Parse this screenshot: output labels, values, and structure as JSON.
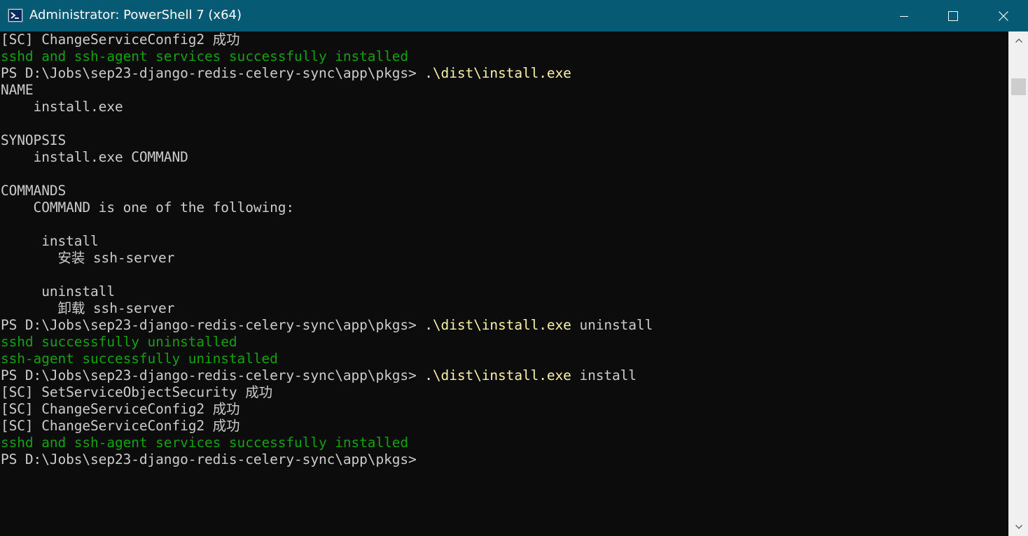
{
  "window": {
    "title": "Administrator: PowerShell 7 (x64)",
    "icon": "powershell-icon",
    "controls": [
      "minimize-icon",
      "maximize-icon",
      "close-icon"
    ]
  },
  "colors": {
    "titlebar": "#065a73",
    "console_bg": "#0c0c0c",
    "default_text": "#cccccc",
    "command_text": "#f9f1a5",
    "success_text": "#13a10e"
  },
  "console": {
    "lines": [
      [
        {
          "text": "[SC] ChangeServiceConfig2 成功",
          "style": "default"
        }
      ],
      [
        {
          "text": "sshd and ssh-agent services successfully installed",
          "style": "ok"
        }
      ],
      [
        {
          "text": "PS D:\\Jobs\\sep23-django-redis-celery-sync\\app\\pkgs> ",
          "style": "default"
        },
        {
          "text": ".\\dist\\install.exe",
          "style": "cmd"
        }
      ],
      [
        {
          "text": "NAME",
          "style": "default"
        }
      ],
      [
        {
          "text": "    install.exe",
          "style": "default"
        }
      ],
      [
        {
          "text": "",
          "style": "default"
        }
      ],
      [
        {
          "text": "SYNOPSIS",
          "style": "default"
        }
      ],
      [
        {
          "text": "    install.exe COMMAND",
          "style": "default"
        }
      ],
      [
        {
          "text": "",
          "style": "default"
        }
      ],
      [
        {
          "text": "COMMANDS",
          "style": "default"
        }
      ],
      [
        {
          "text": "    COMMAND is one of the following:",
          "style": "default"
        }
      ],
      [
        {
          "text": "",
          "style": "default"
        }
      ],
      [
        {
          "text": "     install",
          "style": "default"
        }
      ],
      [
        {
          "text": "       安装 ssh-server",
          "style": "default"
        }
      ],
      [
        {
          "text": "",
          "style": "default"
        }
      ],
      [
        {
          "text": "     uninstall",
          "style": "default"
        }
      ],
      [
        {
          "text": "       卸载 ssh-server",
          "style": "default"
        }
      ],
      [
        {
          "text": "PS D:\\Jobs\\sep23-django-redis-celery-sync\\app\\pkgs> ",
          "style": "default"
        },
        {
          "text": ".\\dist\\install.exe",
          "style": "cmd"
        },
        {
          "text": " uninstall",
          "style": "default"
        }
      ],
      [
        {
          "text": "sshd successfully uninstalled",
          "style": "ok"
        }
      ],
      [
        {
          "text": "ssh-agent successfully uninstalled",
          "style": "ok"
        }
      ],
      [
        {
          "text": "PS D:\\Jobs\\sep23-django-redis-celery-sync\\app\\pkgs> ",
          "style": "default"
        },
        {
          "text": ".\\dist\\install.exe",
          "style": "cmd"
        },
        {
          "text": " install",
          "style": "default"
        }
      ],
      [
        {
          "text": "[SC] SetServiceObjectSecurity 成功",
          "style": "default"
        }
      ],
      [
        {
          "text": "[SC] ChangeServiceConfig2 成功",
          "style": "default"
        }
      ],
      [
        {
          "text": "[SC] ChangeServiceConfig2 成功",
          "style": "default"
        }
      ],
      [
        {
          "text": "sshd and ssh-agent services successfully installed",
          "style": "ok"
        }
      ],
      [
        {
          "text": "PS D:\\Jobs\\sep23-django-redis-celery-sync\\app\\pkgs>",
          "style": "default"
        }
      ]
    ]
  },
  "scrollbar": {
    "up_icon": "scroll-up-arrow-icon",
    "down_icon": "scroll-down-arrow-icon"
  }
}
